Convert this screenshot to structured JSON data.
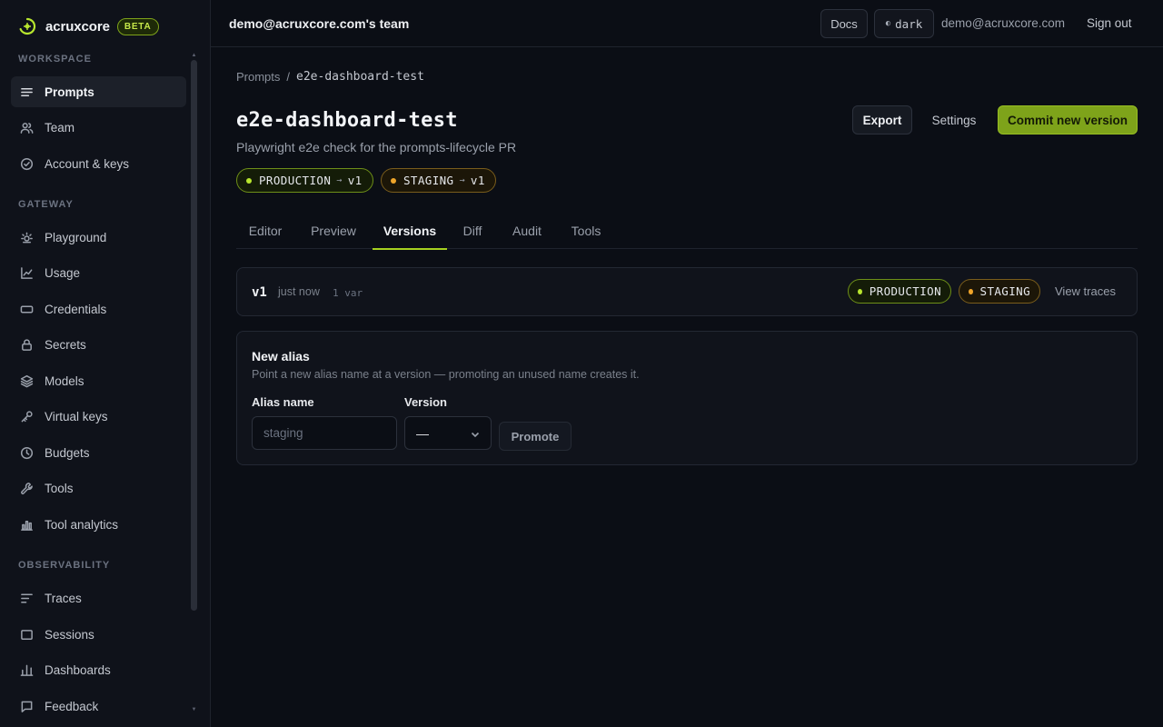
{
  "brand": {
    "name": "acruxcore",
    "badge": "BETA"
  },
  "sidebar": {
    "sections": [
      {
        "label": "WORKSPACE"
      },
      {
        "label": "GATEWAY"
      },
      {
        "label": "OBSERVABILITY"
      }
    ],
    "items": [
      {
        "label": "Prompts",
        "icon": "list-icon",
        "active": true
      },
      {
        "label": "Team",
        "icon": "users-icon"
      },
      {
        "label": "Account & keys",
        "icon": "check-circle-icon"
      },
      {
        "label": "Playground",
        "icon": "sun-icon"
      },
      {
        "label": "Usage",
        "icon": "line-chart-icon"
      },
      {
        "label": "Credentials",
        "icon": "card-icon"
      },
      {
        "label": "Secrets",
        "icon": "lock-icon"
      },
      {
        "label": "Models",
        "icon": "layers-icon"
      },
      {
        "label": "Virtual keys",
        "icon": "key-icon"
      },
      {
        "label": "Budgets",
        "icon": "clock-icon"
      },
      {
        "label": "Tools",
        "icon": "wrench-icon"
      },
      {
        "label": "Tool analytics",
        "icon": "bar-chart-icon"
      },
      {
        "label": "Traces",
        "icon": "traces-icon"
      },
      {
        "label": "Sessions",
        "icon": "window-icon"
      },
      {
        "label": "Dashboards",
        "icon": "bars-icon"
      },
      {
        "label": "Feedback",
        "icon": "message-icon"
      }
    ]
  },
  "topbar": {
    "team": "demo@acruxcore.com's team",
    "docs": "Docs",
    "theme_icon": "◐",
    "theme": "dark",
    "email": "demo@acruxcore.com",
    "signout": "Sign out"
  },
  "breadcrumb": {
    "root": "Prompts",
    "separator": "/",
    "current": "e2e-dashboard-test"
  },
  "prompt": {
    "title": "e2e-dashboard-test",
    "description": "Playwright e2e check for the prompts-lifecycle PR",
    "aliases": [
      {
        "name": "PRODUCTION",
        "arrow": "→",
        "version": "v1",
        "color": "#b8e62e"
      },
      {
        "name": "STAGING",
        "arrow": "→",
        "version": "v1",
        "color": "#f0a52a"
      }
    ]
  },
  "header_actions": {
    "export": "Export",
    "settings": "Settings",
    "commit": "Commit new version"
  },
  "tabs": [
    {
      "label": "Editor"
    },
    {
      "label": "Preview"
    },
    {
      "label": "Versions",
      "active": true
    },
    {
      "label": "Diff"
    },
    {
      "label": "Audit"
    },
    {
      "label": "Tools"
    }
  ],
  "versions": [
    {
      "label": "v1",
      "time": "just now",
      "vars": "1 var",
      "badges": [
        "PRODUCTION",
        "STAGING"
      ],
      "action": "View traces"
    }
  ],
  "new_alias": {
    "title": "New alias",
    "description": "Point a new alias name at a version — promoting an unused name creates it.",
    "alias_label": "Alias name",
    "alias_placeholder": "staging",
    "alias_value": "",
    "version_label": "Version",
    "version_value": "—",
    "promote": "Promote"
  },
  "colors": {
    "accent": "#7ea31a",
    "production": "#b8e62e",
    "staging": "#f0a52a",
    "background": "#0b0e15"
  }
}
